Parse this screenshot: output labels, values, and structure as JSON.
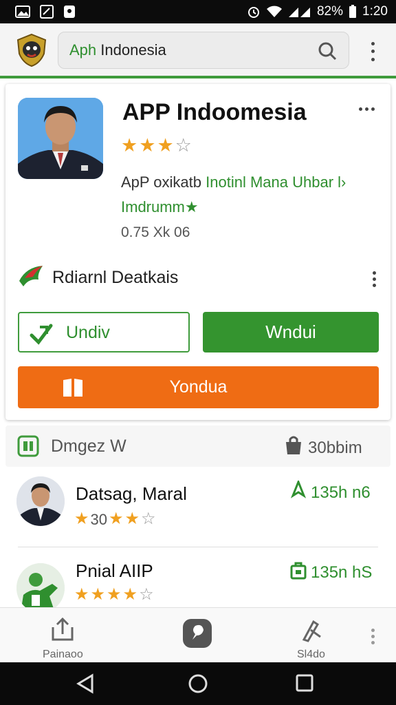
{
  "status_bar": {
    "battery_percent": "82%",
    "time": "1:20"
  },
  "app_bar": {
    "search_prefix": "Aph",
    "search_suffix": "Indonesia",
    "icons": [
      "garuda-logo",
      "search-icon",
      "more-vert-icon"
    ]
  },
  "app_card": {
    "title": "APP Indoomesia",
    "rating": {
      "value": 3,
      "max": 4
    },
    "desc_prefix": "ApP  oxikatb",
    "desc_green": "Inotinl Mana Uhbar l",
    "desc_line2": "Imdrumm",
    "meta": "0.75 Xk 06",
    "developer_name": "Rdiarnl Deatkais",
    "buttons": {
      "outline_label": "Undiv",
      "green_label": "Wndui",
      "orange_label": "Yondua"
    },
    "colors": {
      "green": "#34942f",
      "orange": "#ef6c14",
      "star": "#f0a020"
    }
  },
  "section": {
    "title": "Dmgez  W",
    "right_text": "30bbim",
    "items": [
      {
        "name": "Datsag, Maral",
        "stars_prefix": "30",
        "rating": 3,
        "max": 4,
        "right_text": "135h n6"
      },
      {
        "name": "Pnial AIIP",
        "stars_prefix": "",
        "rating": 4,
        "max": 5,
        "right_text": "135n hS"
      }
    ]
  },
  "bottom_nav": {
    "left_label": "Painaoo",
    "right_label": "Sl4do"
  }
}
